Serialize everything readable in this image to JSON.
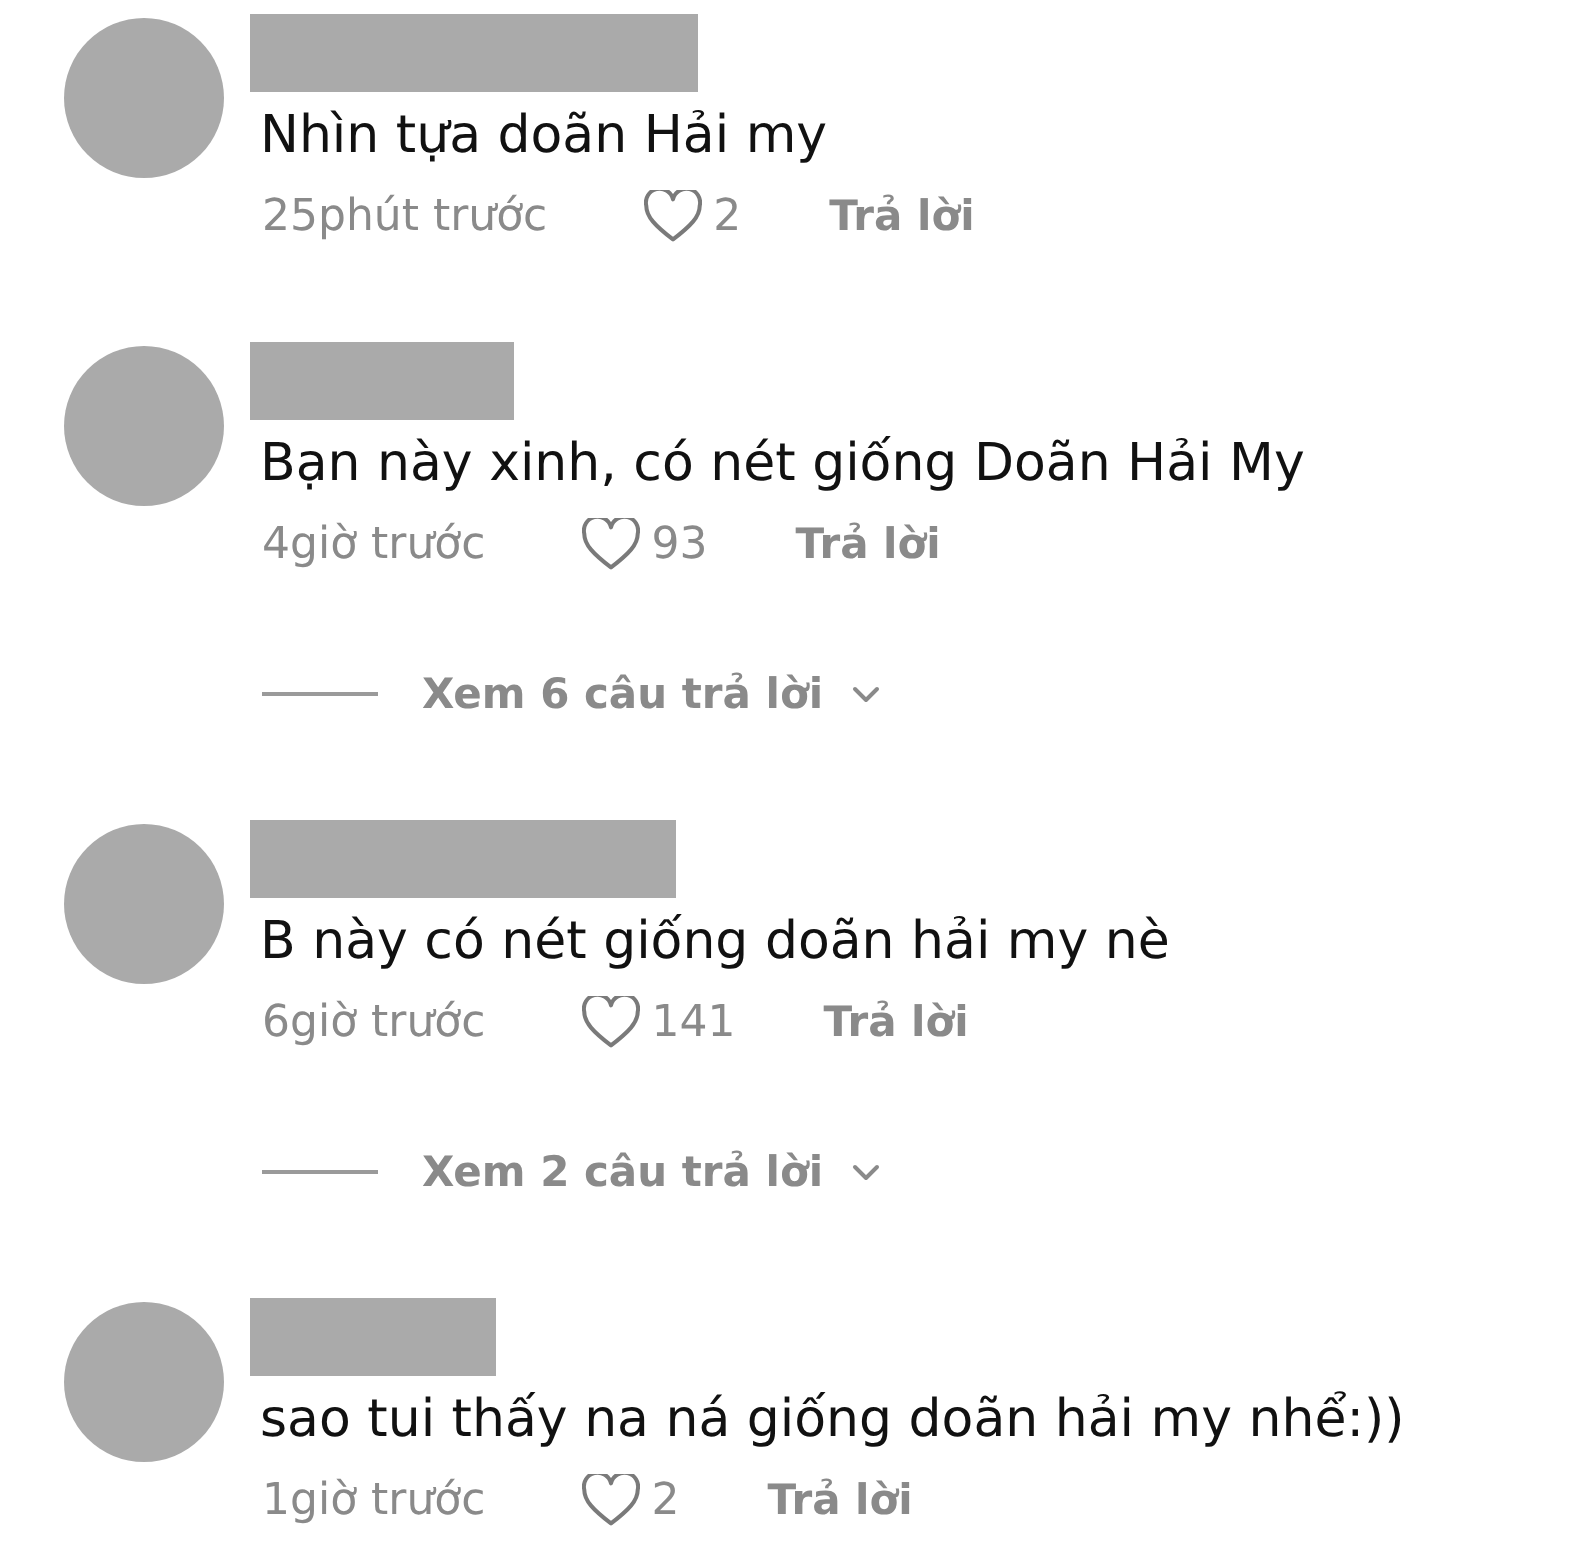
{
  "comments": [
    {
      "text": "Nhìn tựa doãn Hải my",
      "time": "25phút trước",
      "liked": false,
      "likes": "2",
      "reply_label": "Trả lời"
    },
    {
      "text": "Bạn này xinh, có nét giống Doãn Hải My",
      "time": "4giờ trước",
      "liked": false,
      "likes": "93",
      "reply_label": "Trả lời",
      "view_replies": "Xem 6 câu trả lời"
    },
    {
      "text": "B này có nét giống doãn hải my nè",
      "time": "6giờ trước",
      "liked": false,
      "likes": "141",
      "reply_label": "Trả lời",
      "view_replies": "Xem 2 câu trả lời"
    },
    {
      "text": "sao tui thấy na ná giống doãn hải my nhể:))",
      "time": "1giờ trước",
      "liked": false,
      "likes": "2",
      "reply_label": "Trả lời"
    }
  ]
}
